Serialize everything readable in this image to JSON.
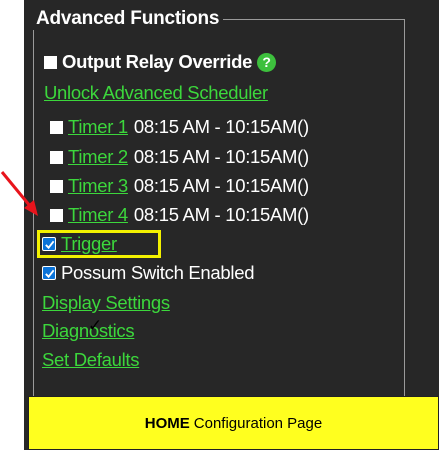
{
  "panel": {
    "legend": "Advanced Functions",
    "output_relay_override": "Output Relay Override",
    "help_icon": "?",
    "unlock_link": "Unlock Advanced Scheduler",
    "timers": [
      {
        "link": "Timer 1",
        "schedule": "08:15 AM - 10:15AM()"
      },
      {
        "link": "Timer 2",
        "schedule": "08:15 AM - 10:15AM()"
      },
      {
        "link": "Timer 3",
        "schedule": "08:15 AM - 10:15AM()"
      },
      {
        "link": "Timer 4",
        "schedule": "08:15 AM - 10:15AM()"
      }
    ],
    "trigger_link": "Trigger",
    "trigger_checked": true,
    "possum_label": "Possum Switch Enabled",
    "possum_checked": true,
    "display_settings": "Display Settings",
    "diagnostics": "Diagnostics",
    "set_defaults": "Set Defaults"
  },
  "caption": {
    "bold": "HOME",
    "text": "Configuration Page"
  },
  "colors": {
    "panel_bg": "#272727",
    "link": "#3cd73c",
    "highlight": "#f3f100",
    "caption_bg": "#ffff1f",
    "arrow": "#e8141c",
    "checkbox": "#0a73d9"
  },
  "icons": {
    "arrow": "red-arrow-icon",
    "help": "help-icon",
    "checkmark": "checkmark-icon",
    "cursor_tick": "tick-mark-icon"
  }
}
